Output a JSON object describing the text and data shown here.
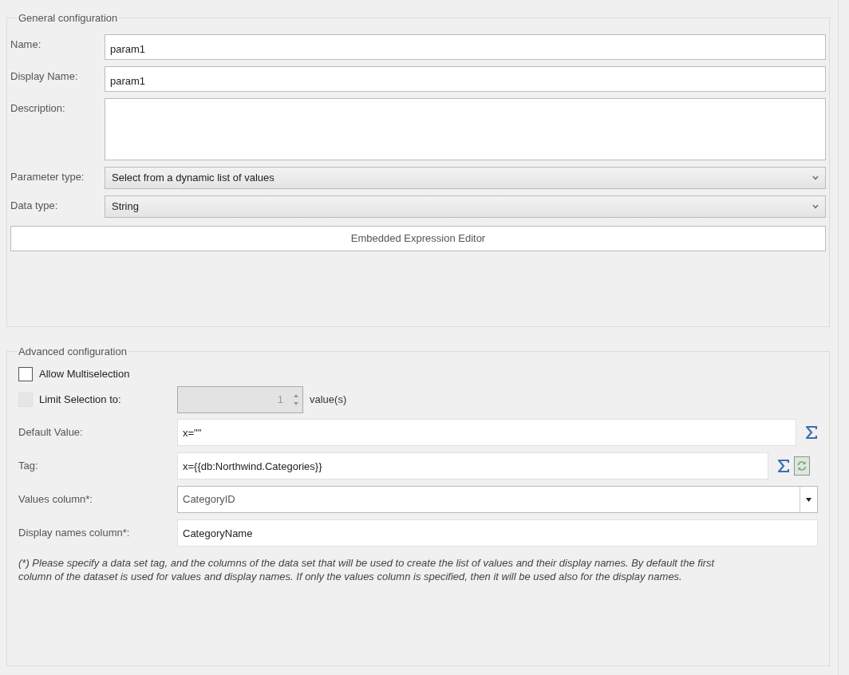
{
  "general": {
    "legend": "General configuration",
    "fields": [
      {
        "kind": "text",
        "label": "Name:",
        "value": "param1"
      },
      {
        "kind": "text",
        "label": "Display Name:",
        "value": "param1"
      },
      {
        "kind": "textarea",
        "label": "Description:"
      },
      {
        "kind": "select",
        "label": "Parameter type:",
        "value": "Select from a dynamic list of values"
      },
      {
        "kind": "select",
        "label": "Data type:",
        "value": "String"
      }
    ],
    "button": "Embedded Expression Editor"
  },
  "advanced": {
    "legend": "Advanced configuration",
    "multiselect": {
      "label": "Allow Multiselection",
      "checked": false,
      "disabled": false
    },
    "limit": {
      "label": "Limit Selection to:",
      "checked": false,
      "disabled": true,
      "value": "1",
      "suffix": "value(s)"
    },
    "fields": [
      {
        "kind": "expression",
        "label": "Default Value:",
        "value": "x=\"\""
      },
      {
        "kind": "expression_refresh",
        "label": "Tag:",
        "value": "x={{db:Northwind.Categories}}"
      },
      {
        "kind": "combo",
        "label": "Values column*:",
        "value": "CategoryID"
      },
      {
        "kind": "text",
        "label": "Display names column*:",
        "value": "CategoryName"
      }
    ],
    "note": "(*) Please specify a data set tag, and the columns of the data set that will be used to create the list of values and their display names. By default the first column of the dataset is used for values and display names. If only the values column is specified, then it will be used also for the display names."
  }
}
